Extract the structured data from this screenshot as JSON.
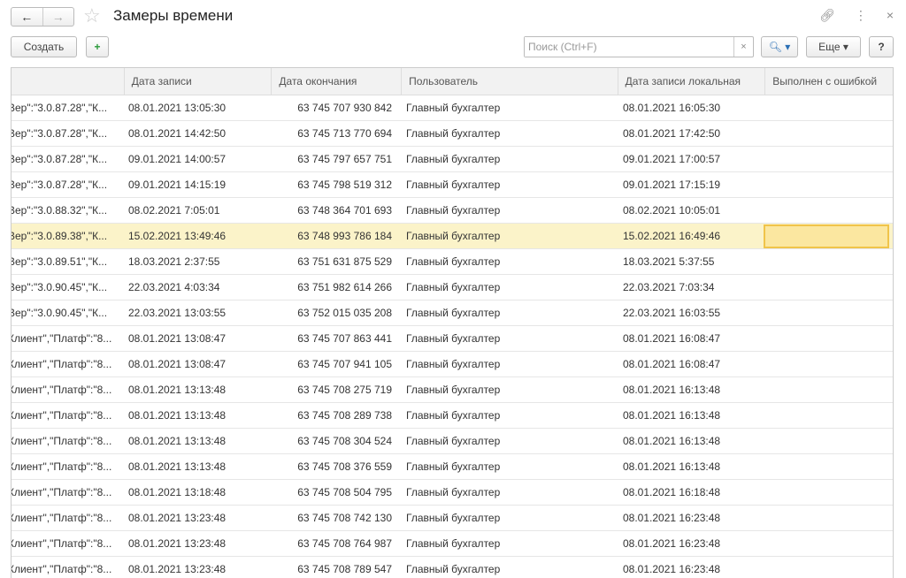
{
  "window": {
    "title": "Замеры времени",
    "back": "←",
    "forward": "→"
  },
  "toolbar": {
    "create": "Создать",
    "search_placeholder": "Поиск (Ctrl+F)",
    "search_clear": "×",
    "more": "Еще ▾",
    "help": "?"
  },
  "columns": [
    "",
    "Дата записи",
    "Дата окончания",
    "Пользователь",
    "Дата записи локальная",
    "Выполнен с ошибкой"
  ],
  "selected_row": 5,
  "rows": [
    [
      "Вер\":\"3.0.87.28\",\"К...",
      "08.01.2021 13:05:30",
      "63 745 707 930 842",
      "Главный бухгалтер",
      "08.01.2021 16:05:30",
      ""
    ],
    [
      "Вер\":\"3.0.87.28\",\"К...",
      "08.01.2021 14:42:50",
      "63 745 713 770 694",
      "Главный бухгалтер",
      "08.01.2021 17:42:50",
      ""
    ],
    [
      "Вер\":\"3.0.87.28\",\"К...",
      "09.01.2021 14:00:57",
      "63 745 797 657 751",
      "Главный бухгалтер",
      "09.01.2021 17:00:57",
      ""
    ],
    [
      "Вер\":\"3.0.87.28\",\"К...",
      "09.01.2021 14:15:19",
      "63 745 798 519 312",
      "Главный бухгалтер",
      "09.01.2021 17:15:19",
      ""
    ],
    [
      "Вер\":\"3.0.88.32\",\"К...",
      "08.02.2021 7:05:01",
      "63 748 364 701 693",
      "Главный бухгалтер",
      "08.02.2021 10:05:01",
      ""
    ],
    [
      "Вер\":\"3.0.89.38\",\"К...",
      "15.02.2021 13:49:46",
      "63 748 993 786 184",
      "Главный бухгалтер",
      "15.02.2021 16:49:46",
      ""
    ],
    [
      "Вер\":\"3.0.89.51\",\"К...",
      "18.03.2021 2:37:55",
      "63 751 631 875 529",
      "Главный бухгалтер",
      "18.03.2021 5:37:55",
      ""
    ],
    [
      "Вер\":\"3.0.90.45\",\"К...",
      "22.03.2021 4:03:34",
      "63 751 982 614 266",
      "Главный бухгалтер",
      "22.03.2021 7:03:34",
      ""
    ],
    [
      "Вер\":\"3.0.90.45\",\"К...",
      "22.03.2021 13:03:55",
      "63 752 015 035 208",
      "Главный бухгалтер",
      "22.03.2021 16:03:55",
      ""
    ],
    [
      "Клиент\",\"Платф\":\"8...",
      "08.01.2021 13:08:47",
      "63 745 707 863 441",
      "Главный бухгалтер",
      "08.01.2021 16:08:47",
      ""
    ],
    [
      "Клиент\",\"Платф\":\"8...",
      "08.01.2021 13:08:47",
      "63 745 707 941 105",
      "Главный бухгалтер",
      "08.01.2021 16:08:47",
      ""
    ],
    [
      "Клиент\",\"Платф\":\"8...",
      "08.01.2021 13:13:48",
      "63 745 708 275 719",
      "Главный бухгалтер",
      "08.01.2021 16:13:48",
      ""
    ],
    [
      "Клиент\",\"Платф\":\"8...",
      "08.01.2021 13:13:48",
      "63 745 708 289 738",
      "Главный бухгалтер",
      "08.01.2021 16:13:48",
      ""
    ],
    [
      "Клиент\",\"Платф\":\"8...",
      "08.01.2021 13:13:48",
      "63 745 708 304 524",
      "Главный бухгалтер",
      "08.01.2021 16:13:48",
      ""
    ],
    [
      "Клиент\",\"Платф\":\"8...",
      "08.01.2021 13:13:48",
      "63 745 708 376 559",
      "Главный бухгалтер",
      "08.01.2021 16:13:48",
      ""
    ],
    [
      "Клиент\",\"Платф\":\"8...",
      "08.01.2021 13:18:48",
      "63 745 708 504 795",
      "Главный бухгалтер",
      "08.01.2021 16:18:48",
      ""
    ],
    [
      "Клиент\",\"Платф\":\"8...",
      "08.01.2021 13:23:48",
      "63 745 708 742 130",
      "Главный бухгалтер",
      "08.01.2021 16:23:48",
      ""
    ],
    [
      "Клиент\",\"Платф\":\"8...",
      "08.01.2021 13:23:48",
      "63 745 708 764 987",
      "Главный бухгалтер",
      "08.01.2021 16:23:48",
      ""
    ],
    [
      "Клиент\",\"Платф\":\"8...",
      "08.01.2021 13:23:48",
      "63 745 708 789 547",
      "Главный бухгалтер",
      "08.01.2021 16:23:48",
      ""
    ]
  ]
}
